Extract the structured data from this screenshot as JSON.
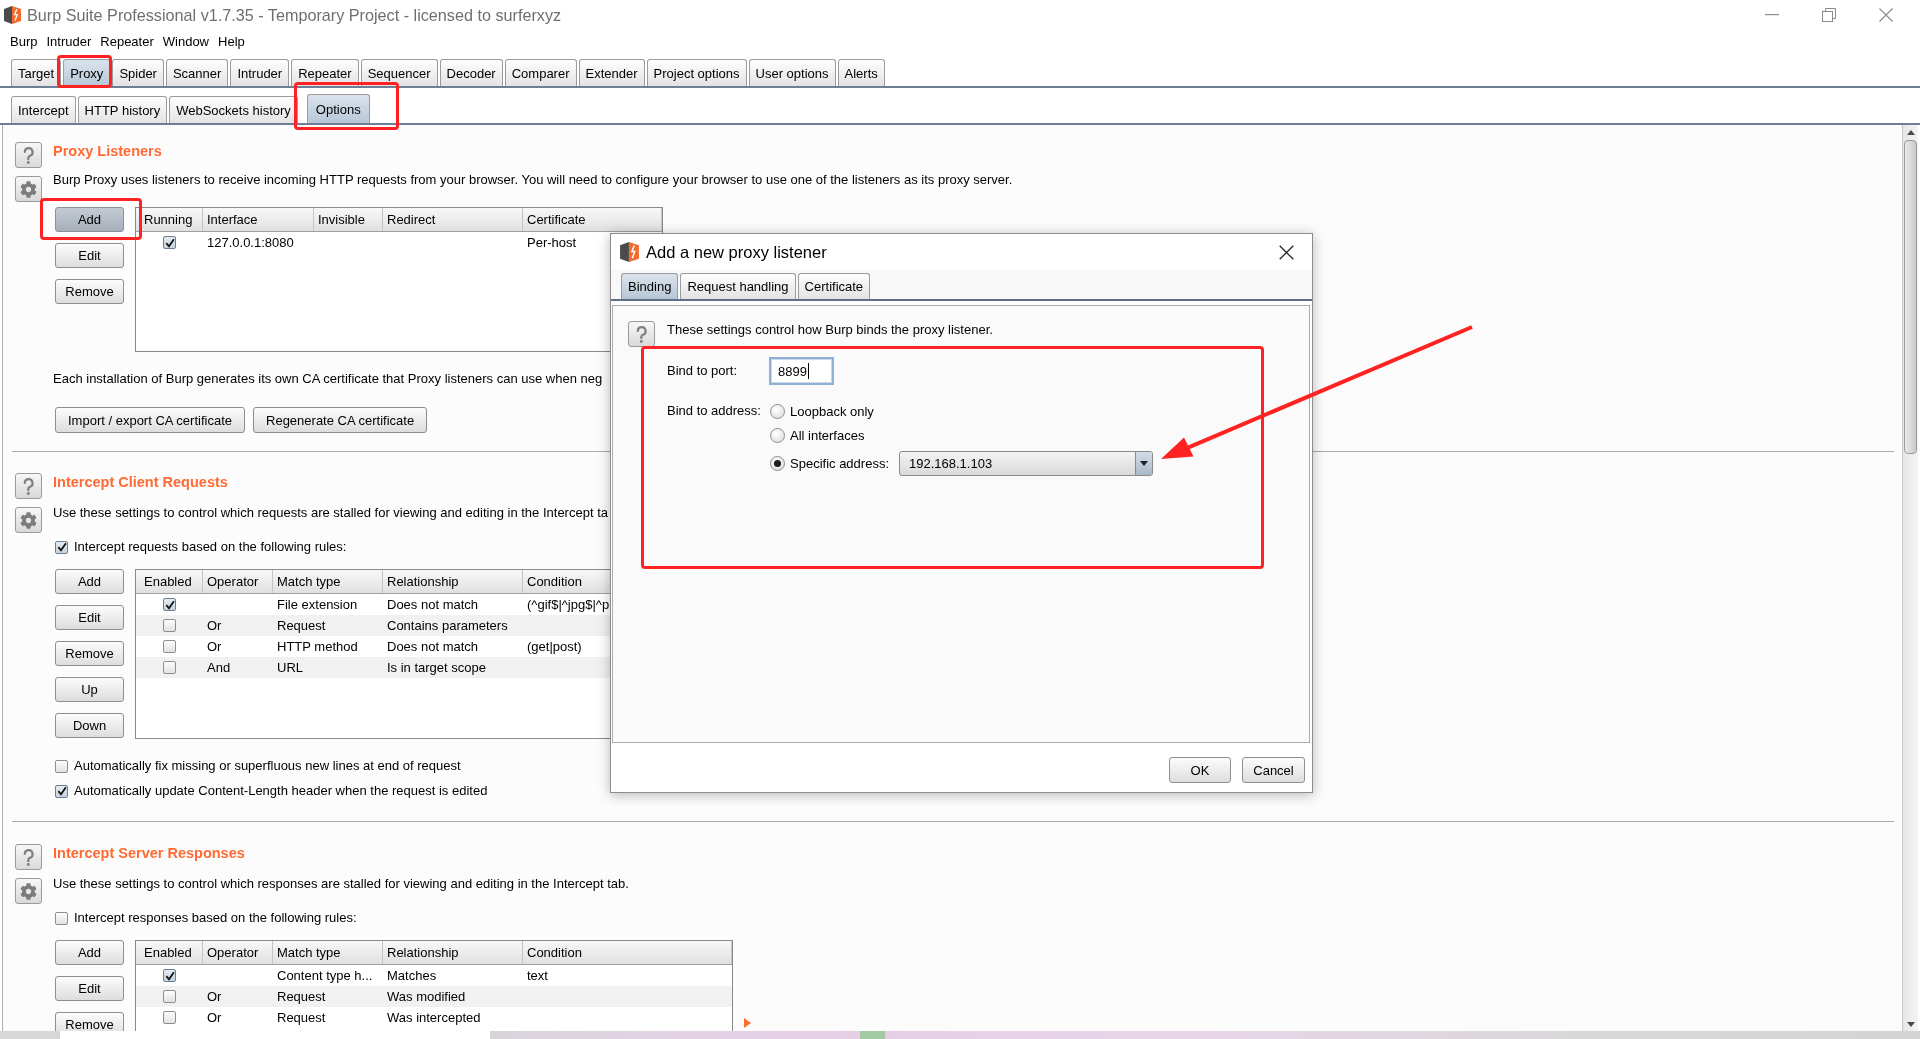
{
  "window": {
    "title": "Burp Suite Professional v1.7.35 - Temporary Project - licensed to surferxyz"
  },
  "menu_bar": [
    "Burp",
    "Intruder",
    "Repeater",
    "Window",
    "Help"
  ],
  "main_tabs": [
    {
      "label": "Target",
      "selected": false
    },
    {
      "label": "Proxy",
      "selected": true
    },
    {
      "label": "Spider",
      "selected": false
    },
    {
      "label": "Scanner",
      "selected": false
    },
    {
      "label": "Intruder",
      "selected": false
    },
    {
      "label": "Repeater",
      "selected": false
    },
    {
      "label": "Sequencer",
      "selected": false
    },
    {
      "label": "Decoder",
      "selected": false
    },
    {
      "label": "Comparer",
      "selected": false
    },
    {
      "label": "Extender",
      "selected": false
    },
    {
      "label": "Project options",
      "selected": false
    },
    {
      "label": "User options",
      "selected": false
    },
    {
      "label": "Alerts",
      "selected": false
    }
  ],
  "sub_tabs": [
    {
      "label": "Intercept",
      "selected": false
    },
    {
      "label": "HTTP history",
      "selected": false
    },
    {
      "label": "WebSockets history",
      "selected": false
    },
    {
      "label": "Options",
      "selected": true
    }
  ],
  "proxy_listeners": {
    "heading": "Proxy Listeners",
    "description": "Burp Proxy uses listeners to receive incoming HTTP requests from your browser. You will need to configure your browser to use one of the listeners as its proxy server.",
    "buttons": [
      {
        "label": "Add",
        "focused": true
      },
      {
        "label": "Edit",
        "focused": false
      },
      {
        "label": "Remove",
        "focused": false
      }
    ],
    "table": {
      "columns": [
        "Running",
        "Interface",
        "Invisible",
        "Redirect",
        "Certificate"
      ],
      "rows": [
        {
          "running": true,
          "interface": "127.0.0.1:8080",
          "certificate": "Per-host"
        }
      ]
    },
    "ca_note": "Each installation of Burp generates its own CA certificate that Proxy listeners can use when neg",
    "ca_buttons": [
      "Import / export CA certificate",
      "Regenerate CA certificate"
    ]
  },
  "intercept_client_requests": {
    "heading": "Intercept Client Requests",
    "description": "Use these settings to control which requests are stalled for viewing and editing in the Intercept ta",
    "rule_toggle": {
      "label": "Intercept requests based on the following rules:",
      "checked": true
    },
    "buttons": [
      "Add",
      "Edit",
      "Remove",
      "Up",
      "Down"
    ],
    "table": {
      "columns": [
        "Enabled",
        "Operator",
        "Match type",
        "Relationship",
        "Condition"
      ],
      "rows": [
        {
          "enabled": true,
          "match_type": "File extension",
          "relationship": "Does not match",
          "condition": "(^gif$|^jpg$|^p"
        },
        {
          "enabled": false,
          "operator": "Or",
          "match_type": "Request",
          "relationship": "Contains parameters"
        },
        {
          "enabled": false,
          "operator": "Or",
          "match_type": "HTTP method",
          "relationship": "Does not match",
          "condition": "(get|post)"
        },
        {
          "enabled": false,
          "operator": "And",
          "match_type": "URL",
          "relationship": "Is in target scope"
        }
      ]
    },
    "options": [
      {
        "label": "Automatically fix missing or superfluous new lines at end of request",
        "checked": false
      },
      {
        "label": "Automatically update Content-Length header when the request is edited",
        "checked": true
      }
    ]
  },
  "intercept_server_responses": {
    "heading": "Intercept Server Responses",
    "description": "Use these settings to control which responses are stalled for viewing and editing in the Intercept tab.",
    "rule_toggle": {
      "label": "Intercept responses based on the following rules:",
      "checked": false
    },
    "buttons": [
      "Add",
      "Edit",
      "Remove"
    ],
    "table": {
      "columns": [
        "Enabled",
        "Operator",
        "Match type",
        "Relationship",
        "Condition"
      ],
      "rows": [
        {
          "enabled": true,
          "match_type": "Content type h...",
          "relationship": "Matches",
          "condition": "text"
        },
        {
          "enabled": false,
          "operator": "Or",
          "match_type": "Request",
          "relationship": "Was modified"
        },
        {
          "enabled": false,
          "operator": "Or",
          "match_type": "Request",
          "relationship": "Was intercepted"
        }
      ]
    }
  },
  "dialog": {
    "title": "Add a new proxy listener",
    "tabs": [
      {
        "label": "Binding",
        "selected": true
      },
      {
        "label": "Request handling",
        "selected": false
      },
      {
        "label": "Certificate",
        "selected": false
      }
    ],
    "intro": "These settings control how Burp binds the proxy listener.",
    "port_label": "Bind to port:",
    "port_value": "8899",
    "address_label": "Bind to address:",
    "address_options": [
      {
        "label": "Loopback only",
        "selected": false
      },
      {
        "label": "All interfaces",
        "selected": false
      },
      {
        "label": "Specific address:",
        "selected": true
      }
    ],
    "specific_address": "192.168.1.103",
    "buttons": [
      "OK",
      "Cancel"
    ]
  }
}
